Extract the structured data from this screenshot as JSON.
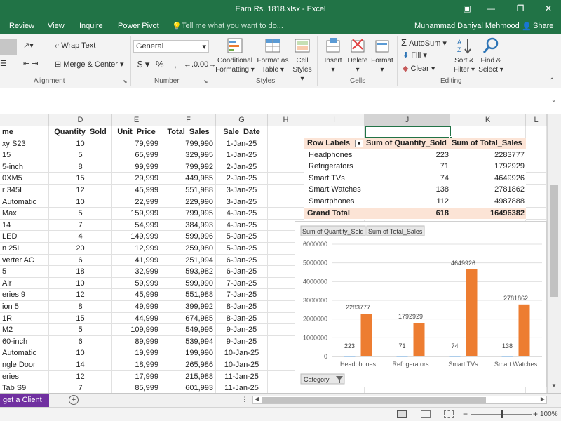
{
  "window": {
    "title": "Earn Rs. 1818.xlsx - Excel"
  },
  "menu": {
    "review": "Review",
    "view": "View",
    "inquire": "Inquire",
    "power_pivot": "Power Pivot",
    "tell_me": "Tell me what you want to do...",
    "user": "Muhammad Daniyal Mehmood",
    "share": "Share"
  },
  "ribbon": {
    "wrap_text": "Wrap Text",
    "merge_center": "Merge & Center",
    "number_format": "General",
    "dollar": "$",
    "percent": "%",
    "comma": ",",
    "conditional": "Conditional",
    "formatting": "Formatting",
    "format_as": "Format as",
    "table": "Table",
    "cell": "Cell",
    "styles_btn": "Styles",
    "insert": "Insert",
    "delete": "Delete",
    "format": "Format",
    "autosum": "AutoSum",
    "fill": "Fill",
    "clear": "Clear",
    "sort": "Sort &",
    "filter": "Filter",
    "find": "Find &",
    "select": "Select",
    "groups": {
      "alignment": "Alignment",
      "number": "Number",
      "styles": "Styles",
      "cells": "Cells",
      "editing": "Editing"
    }
  },
  "columns": [
    "D",
    "E",
    "F",
    "G",
    "H",
    "I",
    "J",
    "K",
    "L"
  ],
  "headers": {
    "name": "me",
    "qty": "Quantity_Sold",
    "price": "Unit_Price",
    "total": "Total_Sales",
    "date": "Sale_Date"
  },
  "rows": [
    {
      "name": "xy S23",
      "qty": "10",
      "price": "79,999",
      "total": "799,990",
      "date": "1-Jan-25"
    },
    {
      "name": "15",
      "qty": "5",
      "price": "65,999",
      "total": "329,995",
      "date": "1-Jan-25"
    },
    {
      "name": "5-inch",
      "qty": "8",
      "price": "99,999",
      "total": "799,992",
      "date": "2-Jan-25"
    },
    {
      "name": "0XM5",
      "qty": "15",
      "price": "29,999",
      "total": "449,985",
      "date": "2-Jan-25"
    },
    {
      "name": "r 345L",
      "qty": "12",
      "price": "45,999",
      "total": "551,988",
      "date": "3-Jan-25"
    },
    {
      "name": "Automatic",
      "qty": "10",
      "price": "22,999",
      "total": "229,990",
      "date": "3-Jan-25"
    },
    {
      "name": "Max",
      "qty": "5",
      "price": "159,999",
      "total": "799,995",
      "date": "4-Jan-25"
    },
    {
      "name": "14",
      "qty": "7",
      "price": "54,999",
      "total": "384,993",
      "date": "4-Jan-25"
    },
    {
      "name": "LED",
      "qty": "4",
      "price": "149,999",
      "total": "599,996",
      "date": "5-Jan-25"
    },
    {
      "name": "n 25L",
      "qty": "20",
      "price": "12,999",
      "total": "259,980",
      "date": "5-Jan-25"
    },
    {
      "name": "verter AC",
      "qty": "6",
      "price": "41,999",
      "total": "251,994",
      "date": "6-Jan-25"
    },
    {
      "name": "5",
      "qty": "18",
      "price": "32,999",
      "total": "593,982",
      "date": "6-Jan-25"
    },
    {
      "name": "Air",
      "qty": "10",
      "price": "59,999",
      "total": "599,990",
      "date": "7-Jan-25"
    },
    {
      "name": "eries 9",
      "qty": "12",
      "price": "45,999",
      "total": "551,988",
      "date": "7-Jan-25"
    },
    {
      "name": "ion 5",
      "qty": "8",
      "price": "49,999",
      "total": "399,992",
      "date": "8-Jan-25"
    },
    {
      "name": "1R",
      "qty": "15",
      "price": "44,999",
      "total": "674,985",
      "date": "8-Jan-25"
    },
    {
      "name": "M2",
      "qty": "5",
      "price": "109,999",
      "total": "549,995",
      "date": "9-Jan-25"
    },
    {
      "name": "60-inch",
      "qty": "6",
      "price": "89,999",
      "total": "539,994",
      "date": "9-Jan-25"
    },
    {
      "name": "Automatic",
      "qty": "10",
      "price": "19,999",
      "total": "199,990",
      "date": "10-Jan-25"
    },
    {
      "name": "ngle Door",
      "qty": "14",
      "price": "18,999",
      "total": "265,986",
      "date": "10-Jan-25"
    },
    {
      "name": "eries",
      "qty": "12",
      "price": "17,999",
      "total": "215,988",
      "date": "11-Jan-25"
    },
    {
      "name": "Tab S9",
      "qty": "7",
      "price": "85,999",
      "total": "601,993",
      "date": "11-Jan-25"
    }
  ],
  "pivot": {
    "headers": [
      "Row Labels",
      "Sum of  Quantity_Sold",
      "Sum of  Total_Sales"
    ],
    "rows": [
      {
        "label": "Headphones",
        "qty": "223",
        "total": "2283777"
      },
      {
        "label": "Refrigerators",
        "qty": "71",
        "total": "1792929"
      },
      {
        "label": "Smart TVs",
        "qty": "74",
        "total": "4649926"
      },
      {
        "label": "Smart Watches",
        "qty": "138",
        "total": "2781862"
      },
      {
        "label": "Smartphones",
        "qty": "112",
        "total": "4987888"
      }
    ],
    "grand": {
      "label": "Grand Total",
      "qty": "618",
      "total": "16496382"
    }
  },
  "chart_data": {
    "type": "bar",
    "field_buttons": [
      "Sum of  Quantity_Sold",
      "Sum of  Total_Sales"
    ],
    "category_button": "Category",
    "categories": [
      "Headphones",
      "Refrigerators",
      "Smart TVs",
      "Smart Watches"
    ],
    "series": [
      {
        "name": "Sum of  Quantity_Sold",
        "values": [
          223,
          71,
          74,
          138
        ]
      },
      {
        "name": "Sum of  Total_Sales",
        "values": [
          2283777,
          1792929,
          4649926,
          2781862
        ]
      }
    ],
    "ylim": [
      0,
      6000000
    ],
    "yticks": [
      "6000000",
      "5000000",
      "4000000",
      "3000000",
      "2000000",
      "1000000",
      "0"
    ],
    "bar_color": "#ED7D31"
  },
  "tabs": {
    "active": "get a Client"
  },
  "status": {
    "zoom": "100%"
  }
}
